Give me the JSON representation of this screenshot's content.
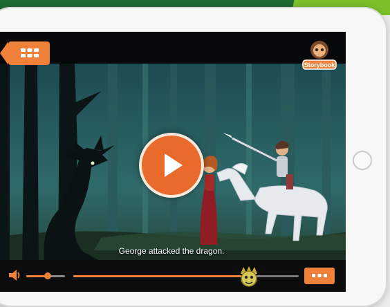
{
  "caption": "George attacked the dragon.",
  "logo_text": "Storybook",
  "playback": {
    "progress": 0.78,
    "volume": 0.55
  },
  "icons": {
    "menu": "grid-icon",
    "play": "play-icon",
    "volume": "speaker-icon",
    "more": "more-icon",
    "scrubber": "character-head-icon"
  },
  "colors": {
    "accent": "#f0813a",
    "play": "#ea6a2b",
    "banner": "#1f6b34"
  }
}
